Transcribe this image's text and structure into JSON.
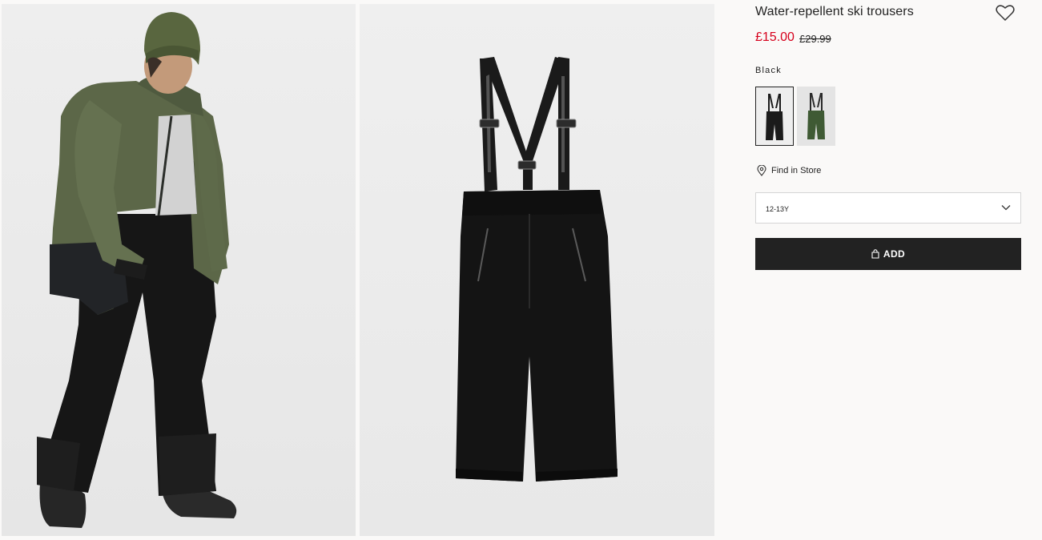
{
  "product": {
    "title": "Water-repellent ski trousers",
    "price": "£15.00",
    "original_price": "£29.99",
    "price_color": "#d6001c"
  },
  "color": {
    "selected_name": "Black",
    "swatches": [
      {
        "name": "Black",
        "hex": "#1b1b1b",
        "selected": true
      },
      {
        "name": "Green",
        "hex": "#3f5a34",
        "selected": false
      }
    ]
  },
  "find_in_store": {
    "label": "Find in Store",
    "icon": "location-pin-icon"
  },
  "size_select": {
    "value": "12-13Y",
    "icon": "chevron-down-icon"
  },
  "add_button": {
    "label": "ADD",
    "icon": "shopping-bag-icon",
    "bg": "#222222"
  },
  "favorite": {
    "icon": "heart-icon"
  },
  "images": [
    {
      "name": "model-photo",
      "icon": "child-model-image"
    },
    {
      "name": "product-photo",
      "icon": "ski-trousers-image"
    }
  ]
}
